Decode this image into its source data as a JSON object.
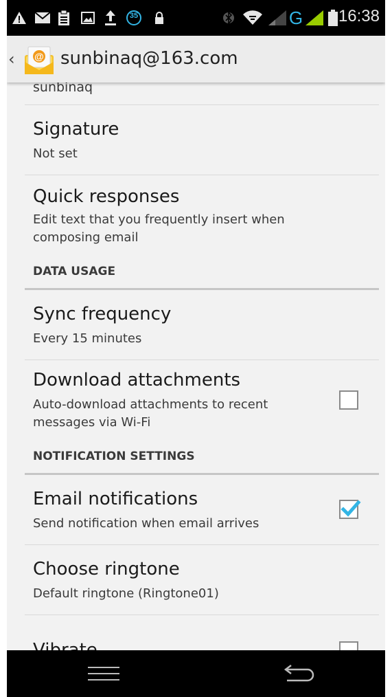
{
  "status_bar": {
    "time": "16:38",
    "notification_badge": "35",
    "network_type": "G"
  },
  "header": {
    "back_glyph": "‹",
    "title": "sunbinaq@163.com",
    "app_icon": "email-app-icon"
  },
  "settings": {
    "partial_top_value": "sunbinaq",
    "signature": {
      "title": "Signature",
      "summary": "Not set"
    },
    "quick_responses": {
      "title": "Quick responses",
      "summary_line1": "Edit text that you frequently insert when",
      "summary_line2": "composing email"
    },
    "data_usage_header": "DATA USAGE",
    "sync_frequency": {
      "title": "Sync frequency",
      "summary": "Every 15 minutes"
    },
    "download_attachments": {
      "title": "Download attachments",
      "summary_line1": "Auto-download attachments to recent",
      "summary_line2": "messages via Wi-Fi",
      "checked": false
    },
    "notification_header": "NOTIFICATION SETTINGS",
    "email_notifications": {
      "title": "Email notifications",
      "summary": "Send notification when email arrives",
      "checked": true
    },
    "choose_ringtone": {
      "title": "Choose ringtone",
      "summary": "Default ringtone (Ringtone01)"
    },
    "vibrate": {
      "title": "Vibrate",
      "checked": false
    }
  },
  "colors": {
    "accent_check": "#33b5e5",
    "signal_green": "#99cc00",
    "g_blue": "#33b5e5"
  }
}
